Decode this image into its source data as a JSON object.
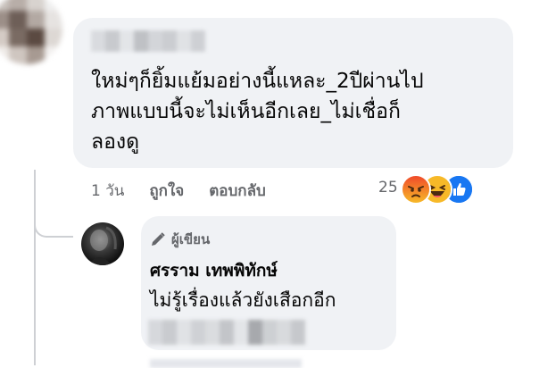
{
  "comment": {
    "text": "ใหม่ๆก็ยิ้มแย้มอย่างนี้แหละ_2ปีผ่านไป\nภาพแบบนี้จะไม่เห็นอีกเลย_ไม่เชื่อก็\nลองดู",
    "time": "1 วัน",
    "like_label": "ถูกใจ",
    "reply_label": "ตอบกลับ",
    "reaction_count": "25",
    "reactions": [
      "angry-react-icon",
      "haha-react-icon",
      "like-react-icon"
    ]
  },
  "reply": {
    "author_badge": "ผู้เขียน",
    "name": "ศรราม เทพพิทักษ์",
    "text": "ไม่รู้เรื่องแล้วยังเสือกอีก"
  },
  "colors": {
    "bubble": "#f0f2f5",
    "secondary_text": "#65676b",
    "like_blue": "#1877f2",
    "angry_orange": "#f25a2a",
    "haha_yellow": "#f7b928"
  }
}
